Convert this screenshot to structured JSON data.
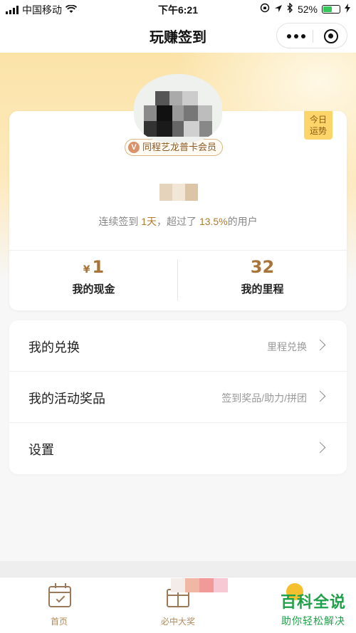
{
  "status_bar": {
    "carrier": "中国移动",
    "time": "下午6:21",
    "battery_text": "52%",
    "battery_level": 0.52,
    "icons": [
      "signal-icon",
      "wifi-icon",
      "lock-rotation-icon",
      "location-icon",
      "bluetooth-icon",
      "battery-icon",
      "charging-icon"
    ]
  },
  "nav": {
    "title": "玩赚签到",
    "more_icon": "more-dots-icon",
    "close_icon": "target-icon"
  },
  "profile": {
    "fortune_line1": "今日",
    "fortune_line2": "运势",
    "member_badge_icon": "V",
    "member_badge": "同程艺龙普卡会员",
    "checkin_prefix": "连续签到 ",
    "checkin_days": "1天",
    "checkin_middle": "，超过了 ",
    "checkin_percent": "13.5%",
    "checkin_suffix": "的用户"
  },
  "stats": {
    "cash_symbol": "¥",
    "cash_value": "1",
    "cash_label": "我的现金",
    "mileage_value": "32",
    "mileage_label": "我的里程"
  },
  "menu": {
    "items": [
      {
        "title": "我的兑换",
        "sub": "里程兑换"
      },
      {
        "title": "我的活动奖品",
        "sub": "签到奖品/助力/拼团"
      },
      {
        "title": "设置",
        "sub": ""
      }
    ]
  },
  "tabs": [
    {
      "label": "首页",
      "icon": "calendar-check-icon"
    },
    {
      "label": "必中大奖",
      "icon": "gift-box-icon"
    },
    {
      "label": "",
      "icon": "coin-icon"
    }
  ],
  "watermark": {
    "main": "百科全说",
    "sub": "助你轻松解决"
  },
  "colors": {
    "accent_gold": "#a8743a",
    "badge_yellow": "#fbd56a",
    "header_gradient": "#fbe3a8",
    "watermark_green": "#1fa14a"
  }
}
